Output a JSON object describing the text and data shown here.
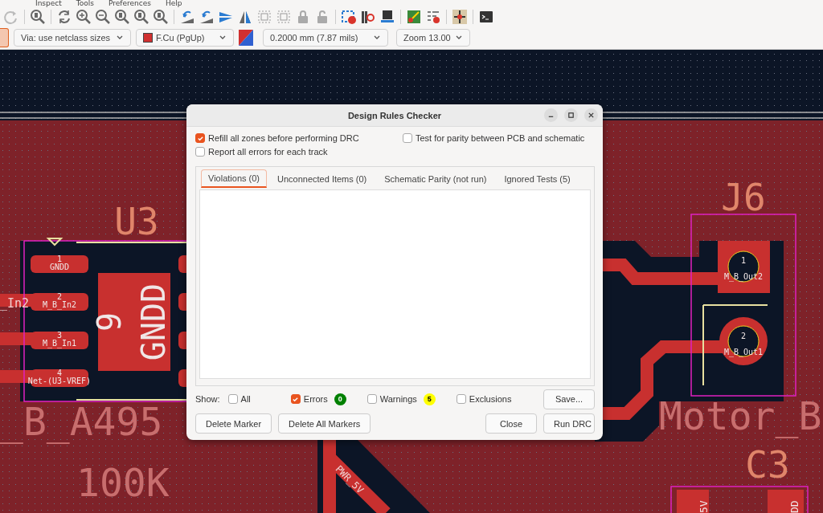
{
  "menu": [
    "Inspect",
    "Tools",
    "Preferences",
    "Help"
  ],
  "toolbar": {
    "via_size": "Via: use netclass sizes",
    "layer": "F.Cu (PgUp)",
    "track_width": "0.2000 mm (7.87 mils)",
    "zoom": "Zoom 13.00"
  },
  "board": {
    "u3": {
      "ref": "U3",
      "value": "_B_A495",
      "net_stub": "_In2",
      "pads": [
        {
          "number": "1",
          "net": "GNDD"
        },
        {
          "number": "2",
          "net": "M_B_In2"
        },
        {
          "number": "3",
          "net": "M_B_In1"
        },
        {
          "number": "4",
          "net": "Net-(U3-VREF)"
        }
      ],
      "exposed_pad": {
        "number": "9",
        "net": "GNDD"
      }
    },
    "resistor_value": "100K",
    "j6": {
      "ref": "J6",
      "value": "Motor_B",
      "pads": [
        {
          "number": "1",
          "net": "M_B_Out2"
        },
        {
          "number": "2",
          "net": "M_B_Out1"
        }
      ]
    },
    "c3": {
      "ref": "C3",
      "pad_nets": [
        "5V",
        "DD"
      ]
    },
    "trace_label": "PWR_5V"
  },
  "dialog": {
    "title": "Design Rules Checker",
    "options": [
      {
        "label": "Refill all zones before performing DRC",
        "checked": true
      },
      {
        "label": "Test for parity between PCB and schematic",
        "checked": false
      },
      {
        "label": "Report all errors for each track",
        "checked": false
      }
    ],
    "tabs": [
      {
        "label": "Violations (0)",
        "selected": true
      },
      {
        "label": "Unconnected Items (0)",
        "selected": false
      },
      {
        "label": "Schematic Parity (not run)",
        "selected": false
      },
      {
        "label": "Ignored Tests (5)",
        "selected": false
      }
    ],
    "show_label": "Show:",
    "filters": [
      {
        "label": "All",
        "checked": false
      },
      {
        "label": "Errors",
        "checked": true,
        "count": "0",
        "color": "#008000"
      },
      {
        "label": "Warnings",
        "checked": false,
        "count": "5",
        "color": "#ffff00"
      },
      {
        "label": "Exclusions",
        "checked": false
      }
    ],
    "save_button": "Save...",
    "left_buttons": [
      "Delete Marker",
      "Delete All Markers"
    ],
    "right_buttons": [
      "Close",
      "Run DRC"
    ]
  }
}
